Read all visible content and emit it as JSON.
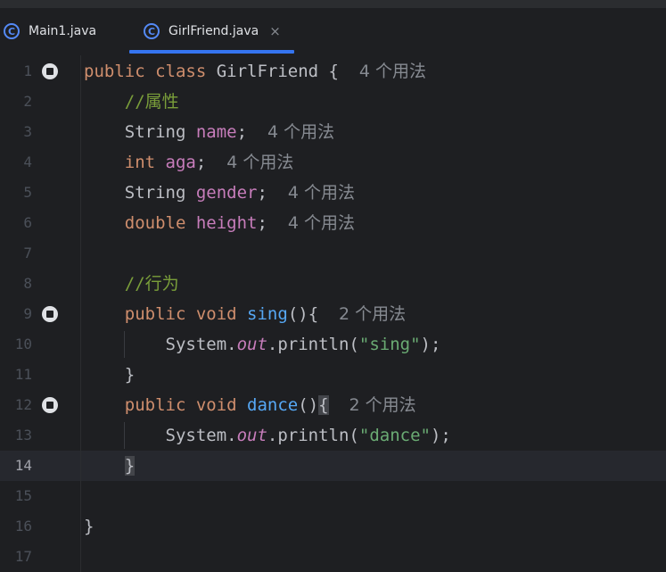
{
  "tabs": [
    {
      "icon": "class-icon",
      "icon_glyph": "C",
      "label": "Main1.java",
      "active": false
    },
    {
      "icon": "class-icon",
      "icon_glyph": "C",
      "label": "GirlFriend.java",
      "active": true,
      "close": "×"
    }
  ],
  "colors": {
    "background": "#1e1f22",
    "keyword": "#cf8e6d",
    "field": "#c77dbb",
    "comment": "#7a9e3a",
    "method": "#56a8f5",
    "string": "#6aab73",
    "inlay_hint": "#868a91",
    "accent": "#3574f0"
  },
  "editor": {
    "current_line": 14,
    "lines": [
      {
        "number": "1",
        "gutter_icon": true,
        "tokens": [
          [
            "kw",
            "public class "
          ],
          [
            "",
            "GirlFriend {  "
          ],
          [
            "hint",
            "4 个用法"
          ]
        ]
      },
      {
        "number": "2",
        "tokens": [
          [
            "",
            "    "
          ],
          [
            "cm",
            "//属性"
          ]
        ]
      },
      {
        "number": "3",
        "tokens": [
          [
            "",
            "    String "
          ],
          [
            "fld",
            "name"
          ],
          [
            "",
            ";  "
          ],
          [
            "hint",
            "4 个用法"
          ]
        ]
      },
      {
        "number": "4",
        "tokens": [
          [
            "",
            "    "
          ],
          [
            "kw",
            "int "
          ],
          [
            "fld",
            "aga"
          ],
          [
            "",
            ";  "
          ],
          [
            "hint",
            "4 个用法"
          ]
        ]
      },
      {
        "number": "5",
        "tokens": [
          [
            "",
            "    String "
          ],
          [
            "fld",
            "gender"
          ],
          [
            "",
            ";  "
          ],
          [
            "hint",
            "4 个用法"
          ]
        ]
      },
      {
        "number": "6",
        "tokens": [
          [
            "",
            "    "
          ],
          [
            "kw",
            "double "
          ],
          [
            "fld",
            "height"
          ],
          [
            "",
            ";  "
          ],
          [
            "hint",
            "4 个用法"
          ]
        ]
      },
      {
        "number": "7",
        "tokens": []
      },
      {
        "number": "8",
        "tokens": [
          [
            "",
            "    "
          ],
          [
            "cm",
            "//行为"
          ]
        ]
      },
      {
        "number": "9",
        "gutter_icon": true,
        "tokens": [
          [
            "",
            "    "
          ],
          [
            "kw",
            "public void "
          ],
          [
            "mth",
            "sing"
          ],
          [
            "",
            "(){  "
          ],
          [
            "hint",
            "2 个用法"
          ]
        ]
      },
      {
        "number": "10",
        "tokens": [
          [
            "",
            "        System."
          ],
          [
            "st",
            "out"
          ],
          [
            "",
            ".println("
          ],
          [
            "str",
            "\"sing\""
          ],
          [
            "",
            ");"
          ]
        ]
      },
      {
        "number": "11",
        "tokens": [
          [
            "",
            "    }"
          ]
        ]
      },
      {
        "number": "12",
        "gutter_icon": true,
        "tokens": [
          [
            "",
            "    "
          ],
          [
            "kw",
            "public void "
          ],
          [
            "mth",
            "dance"
          ],
          [
            "",
            "()"
          ],
          [
            "caret-brace",
            "{"
          ],
          [
            "",
            "  "
          ],
          [
            "hint",
            "2 个用法"
          ]
        ]
      },
      {
        "number": "13",
        "tokens": [
          [
            "",
            "        System."
          ],
          [
            "st",
            "out"
          ],
          [
            "",
            ".println("
          ],
          [
            "str",
            "\"dance\""
          ],
          [
            "",
            ");"
          ]
        ]
      },
      {
        "number": "14",
        "tokens": [
          [
            "",
            "    "
          ],
          [
            "caret-brace",
            "}"
          ]
        ]
      },
      {
        "number": "15",
        "tokens": []
      },
      {
        "number": "16",
        "tokens": [
          [
            "",
            "}"
          ]
        ]
      },
      {
        "number": "17",
        "tokens": []
      }
    ]
  }
}
